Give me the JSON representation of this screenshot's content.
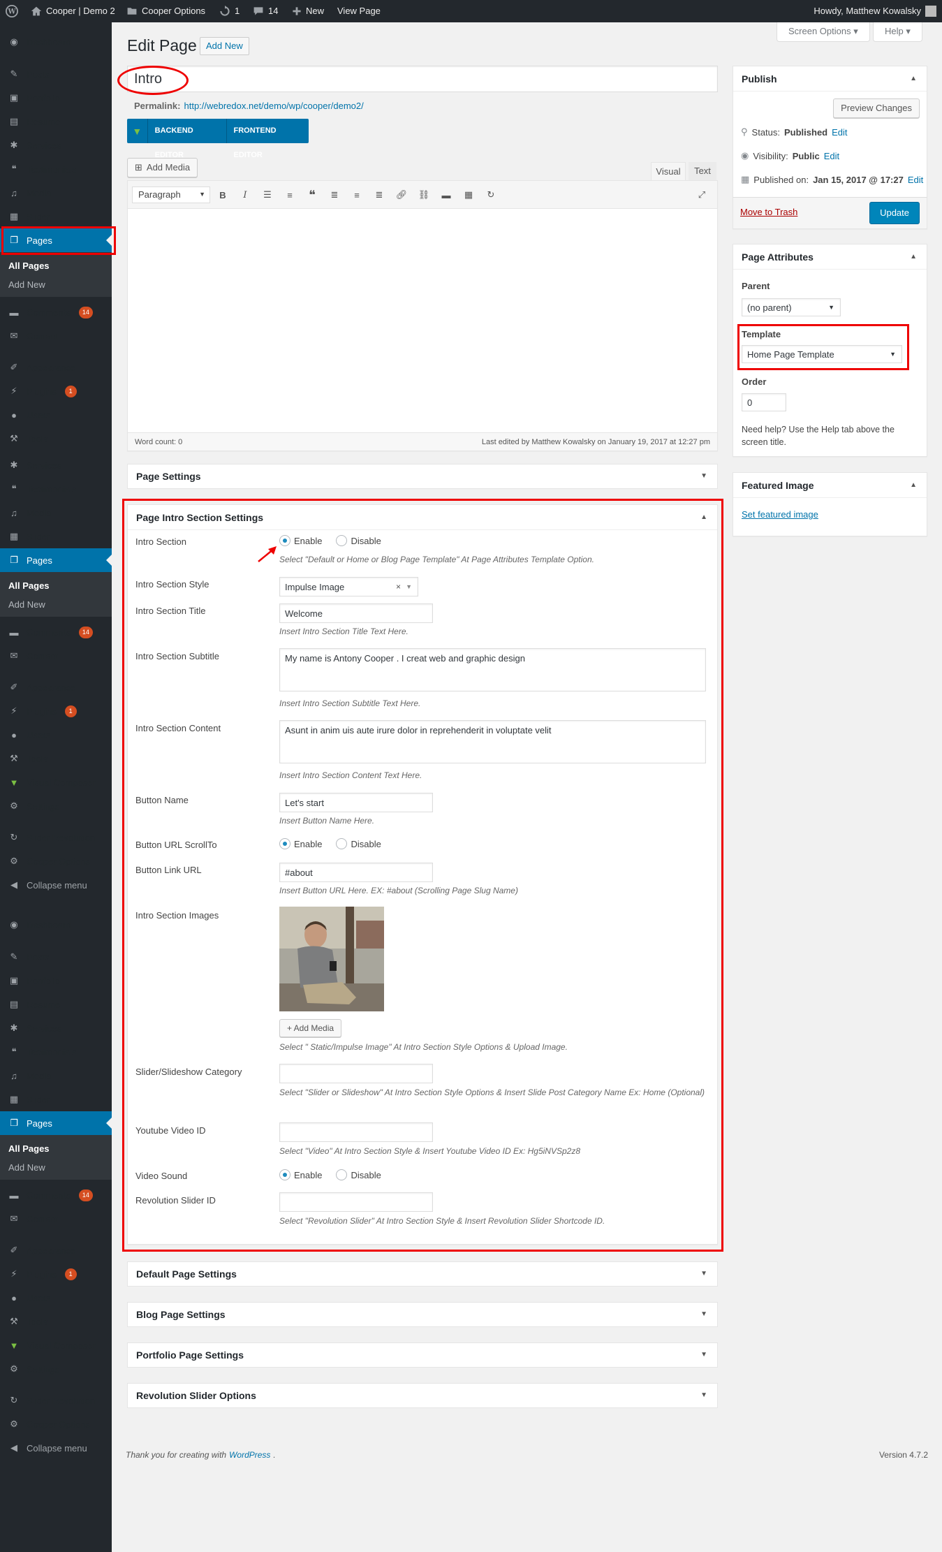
{
  "adminbar": {
    "site_name": "Cooper | Demo 2",
    "options": "Cooper Options",
    "updates": "1",
    "comments": "14",
    "new": "New",
    "view_page": "View Page",
    "howdy": "Howdy, Matthew Kowalsky"
  },
  "sidebar": {
    "group1": {
      "dashboard": "Dashboard",
      "posts": "Posts",
      "portfolio": "Portfolio",
      "resume": "Resume",
      "services": "Services",
      "testimonials": "Testimonials",
      "media": "Media",
      "slider": "Slider",
      "pages": "Pages",
      "all_pages": "All Pages",
      "add_new": "Add New",
      "comments": "Comments",
      "comments_count": "14",
      "contact": "Contact"
    },
    "group2": {
      "appearance": "Appearance",
      "plugins": "Plugins",
      "plugins_count": "1",
      "users": "Users",
      "tools": "Tools",
      "services": "Services",
      "testimonials": "Testimonials",
      "media": "Media",
      "slider": "Slider",
      "pages": "Pages",
      "all_pages": "All Pages",
      "add_new": "Add New",
      "comments": "Comments",
      "comments_count": "14",
      "contact": "Contact"
    },
    "group3": {
      "appearance": "Appearance",
      "plugins": "Plugins",
      "plugins_count": "1",
      "users": "Users",
      "tools": "Tools",
      "visual_composer": "Visual Composer",
      "settings": "Settings",
      "slider_revolution": "Slider Revolution",
      "cooper_options": "Cooper Options",
      "collapse": "Collapse menu"
    },
    "group4": {
      "dashboard": "Dashboard",
      "posts": "Posts",
      "portfolio": "Portfolio",
      "resume": "Resume",
      "services": "Services",
      "testimonials": "Testimonials",
      "media": "Media",
      "slider": "Slider",
      "pages": "Pages",
      "all_pages": "All Pages",
      "add_new": "Add New",
      "comments": "Comments",
      "comments_count": "14",
      "contact": "Contact"
    },
    "group5": {
      "appearance": "Appearance",
      "plugins": "Plugins",
      "plugins_count": "1",
      "users": "Users",
      "tools": "Tools",
      "visual_composer": "Visual Composer",
      "settings": "Settings",
      "slider_revolution": "Slider Revolution",
      "cooper_options": "Cooper Options",
      "collapse": "Collapse menu"
    }
  },
  "screen_options": "Screen Options",
  "help": "Help",
  "page_title": "Edit Page",
  "add_new": "Add New",
  "title_value": "Intro",
  "permalink_label": "Permalink:",
  "permalink_url": "http://webredox.net/demo/wp/cooper/demo2/",
  "backend_editor": "BACKEND EDITOR",
  "frontend_editor": "FRONTEND EDITOR",
  "add_media": "Add Media",
  "tab_visual": "Visual",
  "tab_text": "Text",
  "format_select": "Paragraph",
  "word_count": "Word count: 0",
  "last_edited": "Last edited by Matthew Kowalsky on January 19, 2017 at 12:27 pm",
  "page_settings": "Page Settings",
  "intro_settings": {
    "title": "Page Intro Section Settings",
    "enable": "Enable",
    "disable": "Disable",
    "intro_section_label": "Intro Section",
    "intro_section_hint": "Select \"Default or Home or Blog Page Template\" At Page Attributes Template Option.",
    "style_label": "Intro Section Style",
    "style_value": "Impulse Image",
    "title_label": "Intro Section Title",
    "title_value": "Welcome",
    "title_hint": "Insert Intro Section Title Text Here.",
    "subtitle_label": "Intro Section Subtitle",
    "subtitle_value": "My name is Antony Cooper . I creat web and graphic design",
    "subtitle_hint": "Insert Intro Section Subtitle Text Here.",
    "content_label": "Intro Section Content",
    "content_value": "Asunt in anim uis aute irure dolor in reprehenderit in voluptate velit",
    "content_hint": "Insert Intro Section Content Text Here.",
    "button_name_label": "Button Name",
    "button_name_value": "Let's start",
    "button_name_hint": "Insert Button Name Here.",
    "scrollto_label": "Button URL ScrollTo",
    "link_label": "Button Link URL",
    "link_value": "#about",
    "link_hint": "Insert Button URL Here. EX: #about (Scrolling Page Slug Name)",
    "images_label": "Intro Section Images",
    "images_add": "+ Add Media",
    "images_hint": "Select \" Static/Impulse Image\" At Intro Section Style Options & Upload Image.",
    "slider_cat_label": "Slider/Slideshow Category",
    "slider_cat_hint": "Select \"Slider or Slideshow\" At Intro Section Style Options & Insert Slide Post Category Name Ex: Home (Optional)",
    "youtube_label": "Youtube Video ID",
    "youtube_hint": "Select \"Video\" At Intro Section Style & Insert Youtube Video ID Ex: Hg5iNVSp2z8",
    "sound_label": "Video Sound",
    "rev_label": "Revolution Slider ID",
    "rev_hint": "Select \"Revolution Slider\" At Intro Section Style & Insert Revolution Slider Shortcode ID."
  },
  "default_settings": "Default Page Settings",
  "blog_settings": "Blog Page Settings",
  "portfolio_settings": "Portfolio Page Settings",
  "rev_options": "Revolution Slider Options",
  "footer_thanks": "Thank you for creating with",
  "footer_link": "WordPress",
  "version": "Version 4.7.2",
  "publish": {
    "title": "Publish",
    "preview": "Preview Changes",
    "status_label": "Status:",
    "status_value": "Published",
    "visibility_label": "Visibility:",
    "visibility_value": "Public",
    "published_label": "Published on:",
    "published_value": "Jan 15, 2017 @ 17:27",
    "edit": "Edit",
    "trash": "Move to Trash",
    "update": "Update"
  },
  "attributes": {
    "title": "Page Attributes",
    "parent_label": "Parent",
    "parent_value": "(no parent)",
    "template_label": "Template",
    "template_value": "Home Page Template",
    "order_label": "Order",
    "order_value": "0",
    "help_text": "Need help? Use the Help tab above the screen title."
  },
  "featured": {
    "title": "Featured Image",
    "link": "Set featured image"
  },
  "colors": {
    "accent": "#0073aa",
    "highlight": "#e00000",
    "sidebar": "#23282d"
  }
}
